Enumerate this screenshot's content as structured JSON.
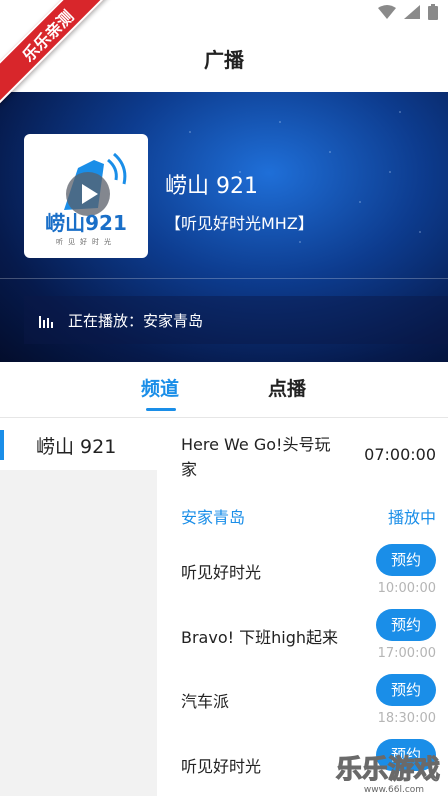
{
  "ribbon": {
    "text": "乐乐亲测"
  },
  "header": {
    "title": "广播"
  },
  "station": {
    "logo_text": "崂山921",
    "logo_sub": "听见好时光",
    "name": "崂山 921",
    "program": "【听见好时光MHZ】",
    "now_playing": "正在播放：安家青岛"
  },
  "tabs": [
    {
      "label": "频道",
      "active": true
    },
    {
      "label": "点播",
      "active": false
    }
  ],
  "channels": [
    {
      "label": "崂山 921",
      "selected": true
    }
  ],
  "schedule": {
    "first": {
      "title_line1": "Here We Go!头号玩",
      "title_line2": "家",
      "time": "07:00:00"
    },
    "current": {
      "title": "安家青岛",
      "status": "播放中"
    },
    "items": [
      {
        "title": "听见好时光",
        "button": "预约",
        "time": "10:00:00"
      },
      {
        "title": "Bravo! 下班high起来",
        "button": "预约",
        "time": "17:00:00"
      },
      {
        "title": "汽车派",
        "button": "预约",
        "time": "18:30:00"
      },
      {
        "title": "听见好时光",
        "button": "预约",
        "time": ""
      }
    ]
  },
  "watermark": {
    "text": "乐乐游戏",
    "url": "www.66l.com"
  },
  "colors": {
    "accent": "#1a8ee8",
    "ribbon": "#d8262b",
    "hero_dark": "#061a4c"
  }
}
